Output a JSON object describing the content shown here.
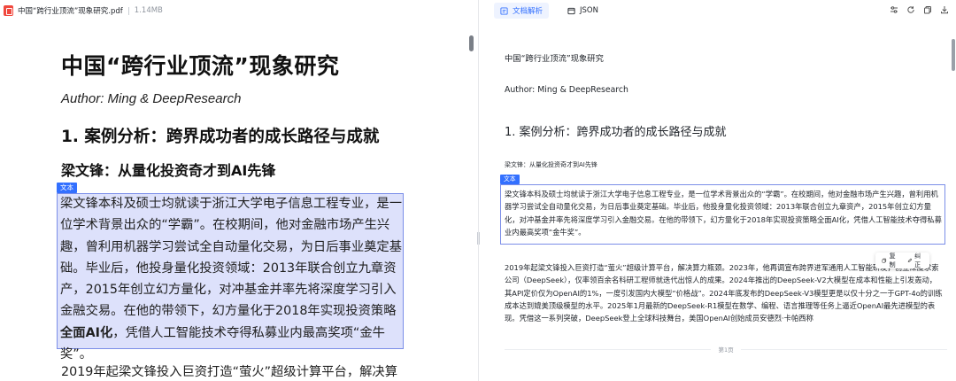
{
  "pdf_viewer": {
    "file_name": "中国“跨行业顶流”现象研究.pdf",
    "file_size": "1.14MB",
    "page": {
      "title": "中国“跨行业顶流”现象研究",
      "author": "Author: Ming & DeepResearch",
      "heading1": "1. 案例分析：跨界成功者的成长路径与成就",
      "heading2": "梁文锋：从量化投资奇才到AI先锋",
      "block_tag": "文本",
      "paragraph_part1": "梁文锋本科及硕士均就读于浙江大学电子信息工程专业，是一位学术背景出众的“学霸”。在校期间，他对金融市场产生兴趣，曾利用机器学习尝试全自动量化交易，为日后事业奠定基础。毕业后，他投身量化投资领域：2013年联合创立九章资产，2015年创立幻方量化，对冲基金并率先将深度学习引入金融交易。在他的带领下，幻方量化于2018年实现投资策略",
      "paragraph_bold": "全面AI化",
      "paragraph_part2": "，凭借人工智能技术夺得私募业内最高奖项“金牛奖”。",
      "paragraph2_start": "2019年起梁文锋投入巨资打造“萤火”超级计算平台，解决算"
    }
  },
  "parsed_view": {
    "tabs": [
      {
        "label": "文档解析",
        "active": true
      },
      {
        "label": "JSON",
        "active": false
      }
    ],
    "title": "中国“跨行业顶流”现象研究",
    "author": "Author: Ming & DeepResearch",
    "heading1": "1. 案例分析：跨界成功者的成长路径与成就",
    "heading2": "梁文锋：从量化投资奇才到AI先锋",
    "block_tag": "文本",
    "paragraph": "梁文锋本科及硕士均就读于浙江大学电子信息工程专业，是一位学术背景出众的“学霸”。在校期间，他对金融市场产生兴趣，曾利用机器学习尝试全自动量化交易，为日后事业奠定基础。毕业后，他投身量化投资领域：2013年联合创立九章资产，2015年创立幻方量化，对冲基金并率先将深度学习引入金融交易。在他的带领下，幻方量化于2018年实现投资策略全面AI化，凭借人工智能技术夺得私募业内最高奖项“金牛奖”。",
    "actions": {
      "copy": "复制",
      "correct": "纠正"
    },
    "paragraph2": "2019年起梁文锋投入巨资打造“萤火”超级计算平台，解决算力瓶颈。2023年，他再调宣布跨界进军通用人工智能研发，创立深度求索公司（DeepSeek），仅率领百余名科研工程师就迭代出惊人的成果。2024年推出的DeepSeek-V2大模型在成本和性能上引发轰动，其API定价仅为OpenAI的1%，一度引发国内大模型“价格战”。2024年底发布的DeepSeek-V3模型更是以仅十分之一于GPT-4o的训练成本达到媲美顶级模型的水平。2025年1月最新的DeepSeek-R1模型在数学、编程、语言推理等任务上逼近OpenAI最先进模型的表现。凭借这一系列突破，DeepSeek登上全球科技舞台，美国OpenAI创始成员安德烈·卡帕西称",
    "page_marker": "第1页"
  },
  "colors": {
    "accent": "#3370ff",
    "highlight": "#d9def8",
    "pdf_red": "#f0483e"
  }
}
